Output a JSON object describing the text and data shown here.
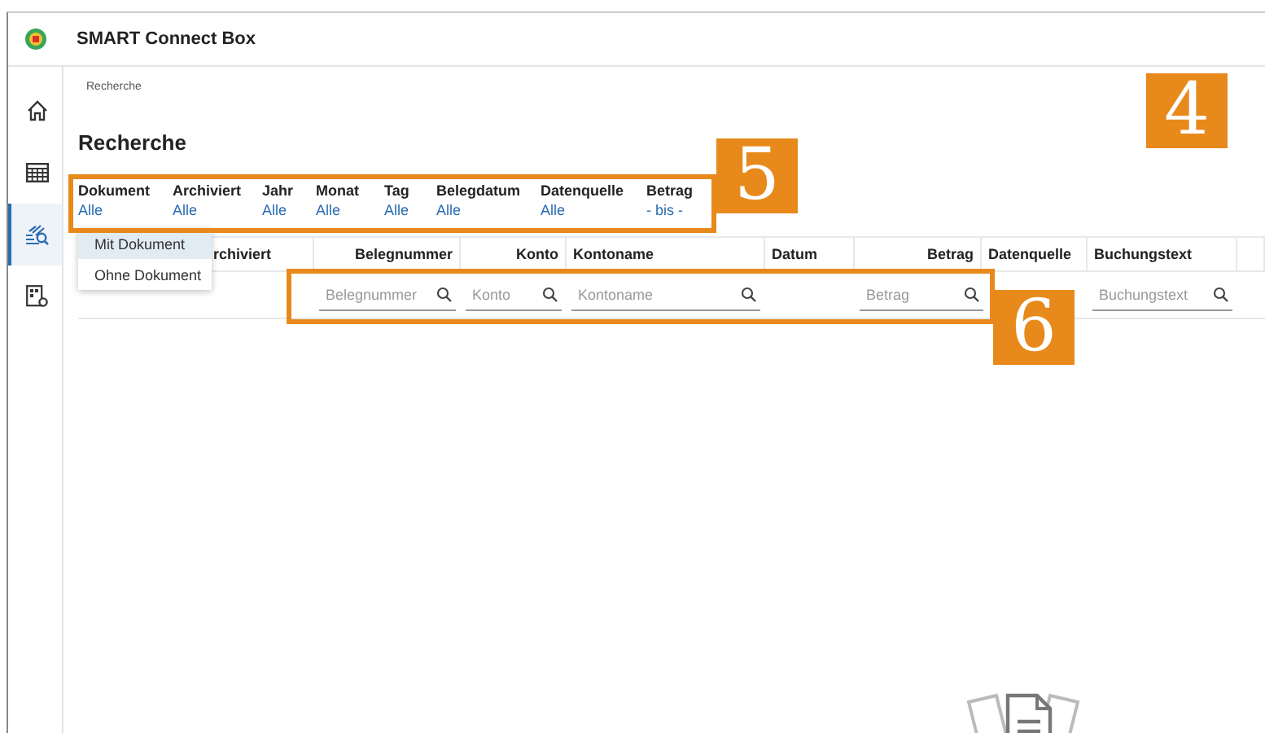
{
  "app": {
    "title": "SMART Connect Box"
  },
  "sidebar": {
    "items": [
      {
        "kind": "home",
        "selected": false
      },
      {
        "kind": "table",
        "selected": false
      },
      {
        "kind": "search",
        "selected": true
      },
      {
        "kind": "settings",
        "selected": false
      }
    ]
  },
  "breadcrumb": "Recherche",
  "heading": "Recherche",
  "filters": [
    {
      "label": "Dokument",
      "value": "Alle"
    },
    {
      "label": "Archiviert",
      "value": "Alle"
    },
    {
      "label": "Jahr",
      "value": "Alle"
    },
    {
      "label": "Monat",
      "value": "Alle"
    },
    {
      "label": "Tag",
      "value": "Alle"
    },
    {
      "label": "Belegdatum",
      "value": "Alle"
    },
    {
      "label": "Datenquelle",
      "value": "Alle"
    },
    {
      "label": "Betrag",
      "value": "- bis -"
    }
  ],
  "dropdown": {
    "items": [
      {
        "label": "Mit Dokument",
        "selected": true
      },
      {
        "label": "Ohne Dokument",
        "selected": false
      }
    ]
  },
  "table": {
    "columns": [
      {
        "label": "rchiviert"
      },
      {
        "label": "Belegnummer",
        "placeholder": "Belegnummer"
      },
      {
        "label": "Konto",
        "placeholder": "Konto"
      },
      {
        "label": "Kontoname",
        "placeholder": "Kontoname"
      },
      {
        "label": "Datum"
      },
      {
        "label": "Betrag",
        "placeholder": "Betrag"
      },
      {
        "label": "Datenquelle"
      },
      {
        "label": "Buchungstext",
        "placeholder": "Buchungstext"
      }
    ]
  },
  "callouts": [
    {
      "number": "4"
    },
    {
      "number": "5"
    },
    {
      "number": "6"
    }
  ]
}
